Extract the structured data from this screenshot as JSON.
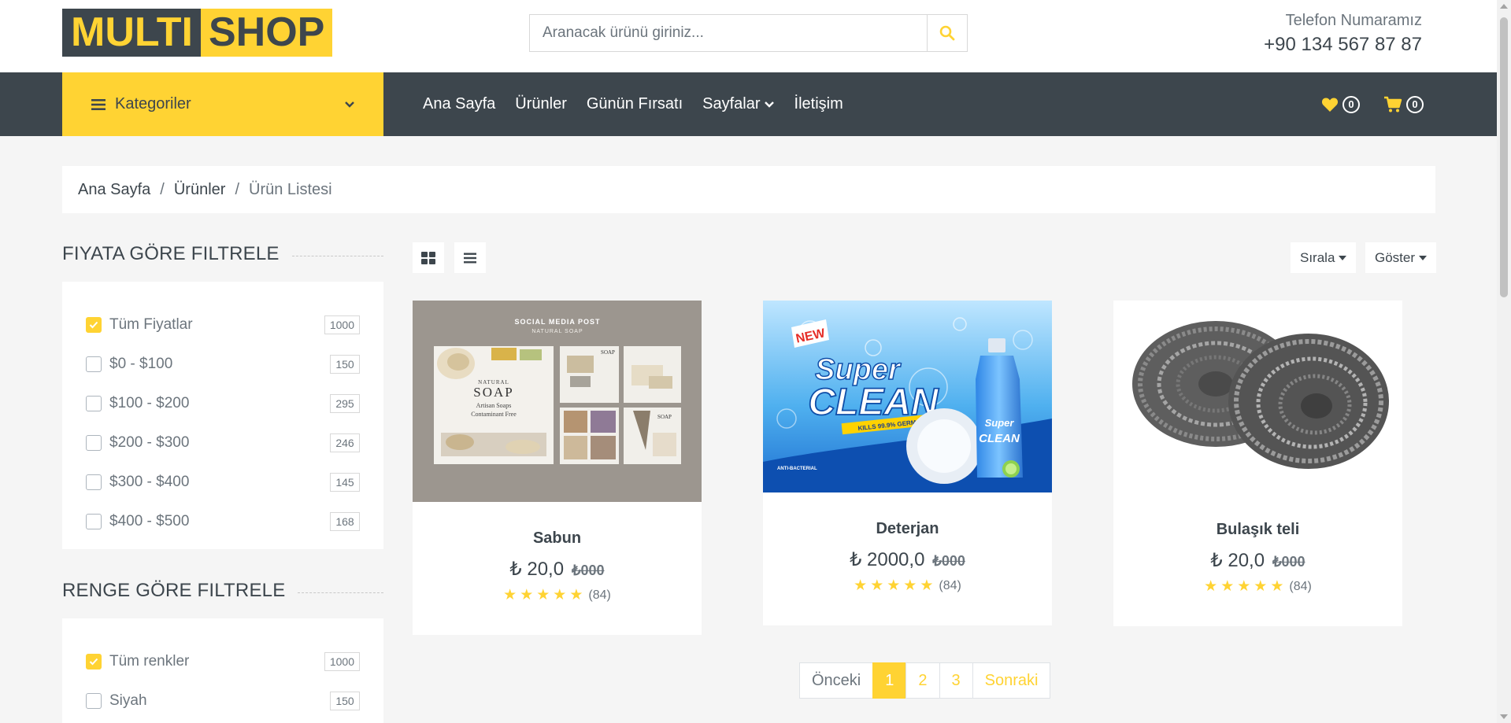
{
  "logo": {
    "part1": "MULTI",
    "part2": "SHOP"
  },
  "search": {
    "placeholder": "Aranacak ürünü giriniz..."
  },
  "contact": {
    "label": "Telefon Numaramız",
    "phone": "+90 134 567 87 87"
  },
  "navbar": {
    "categories_label": "Kategoriler",
    "links": [
      {
        "label": "Ana Sayfa"
      },
      {
        "label": "Ürünler"
      },
      {
        "label": "Günün Fırsatı"
      },
      {
        "label": "Sayfalar"
      },
      {
        "label": "İletişim"
      }
    ],
    "wishlist_count": "0",
    "cart_count": "0"
  },
  "breadcrumb": {
    "items": [
      "Ana Sayfa",
      "Ürünler",
      "Ürün Listesi"
    ]
  },
  "price_filter": {
    "title": "FIYATA GÖRE FILTRELE",
    "options": [
      {
        "label": "Tüm Fiyatlar",
        "count": "1000",
        "checked": true
      },
      {
        "label": "$0 - $100",
        "count": "150",
        "checked": false
      },
      {
        "label": "$100 - $200",
        "count": "295",
        "checked": false
      },
      {
        "label": "$200 - $300",
        "count": "246",
        "checked": false
      },
      {
        "label": "$300 - $400",
        "count": "145",
        "checked": false
      },
      {
        "label": "$400 - $500",
        "count": "168",
        "checked": false
      }
    ]
  },
  "color_filter": {
    "title": "RENGE GÖRE FILTRELE",
    "options": [
      {
        "label": "Tüm renkler",
        "count": "1000",
        "checked": true
      },
      {
        "label": "Siyah",
        "count": "150",
        "checked": false
      }
    ]
  },
  "toolbar": {
    "sort_label": "Sırala",
    "show_label": "Göster"
  },
  "products": [
    {
      "name": "Sabun",
      "price": "₺ 20,0",
      "old_price": "₺000",
      "rating": 5,
      "reviews": "(84)"
    },
    {
      "name": "Deterjan",
      "price": "₺ 2000,0",
      "old_price": "₺000",
      "rating": 5,
      "reviews": "(84)"
    },
    {
      "name": "Bulaşık teli",
      "price": "₺ 20,0",
      "old_price": "₺000",
      "rating": 5,
      "reviews": "(84)"
    }
  ],
  "product_images": {
    "soap": {
      "header": "SOCIAL MEDIA POST",
      "subheader": "NATURAL SOAP",
      "card_title": "NATURAL",
      "card_big": "SOAP",
      "card_line1": "Artisan Soaps",
      "card_line2": "Contaminant Free",
      "tile_label": "SOAP"
    },
    "detergent": {
      "badge": "NEW",
      "line1": "Super",
      "line2": "CLEAN",
      "tagline": "KILLS 99.9% GERMS",
      "footer": "ANTI-BACTERIAL"
    }
  },
  "pagination": {
    "prev": "Önceki",
    "pages": [
      "1",
      "2",
      "3"
    ],
    "next": "Sonraki",
    "active": "1"
  },
  "colors": {
    "accent": "#ffd333",
    "dark": "#3d464d",
    "muted": "#6c757d",
    "background": "#f5f5f5"
  }
}
